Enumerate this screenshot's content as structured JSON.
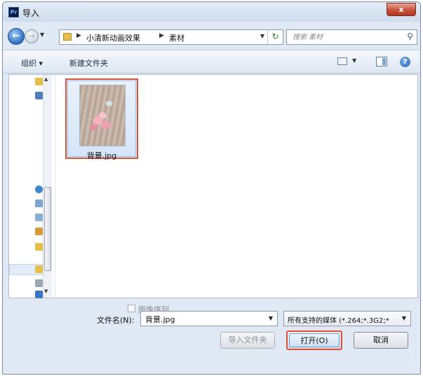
{
  "window": {
    "title": "导入",
    "app_icon_label": "Pr",
    "close_label": "x"
  },
  "address": {
    "crumbs": [
      "小清新动画效果",
      "素材"
    ],
    "search_placeholder": "搜索 素材"
  },
  "toolbar": {
    "organize_label": "组织 ▾",
    "new_folder_label": "新建文件夹",
    "help_label": "?"
  },
  "files": [
    {
      "name": "背景.jpg",
      "selected": true
    }
  ],
  "image_sequence": {
    "label": "图像序列",
    "checked": false
  },
  "filename": {
    "label": "文件名(N):",
    "value": "背景.jpg"
  },
  "filetype": {
    "selected": "所有支持的媒体 (*.264;*.3G2;*"
  },
  "buttons": {
    "import_folder": "导入文件夹",
    "open": "打开(O)",
    "cancel": "取消"
  },
  "colors": {
    "highlight": "#d9533a",
    "selection": "#e3eefb"
  }
}
